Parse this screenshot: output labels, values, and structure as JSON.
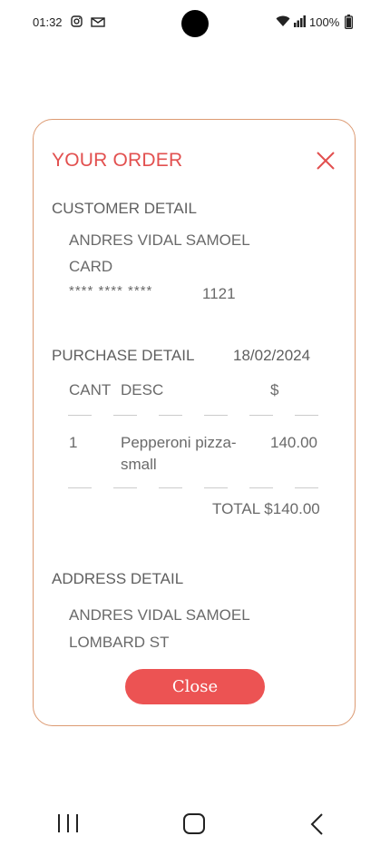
{
  "status_bar": {
    "time": "01:32",
    "battery": "100%",
    "icons": [
      "instagram-icon",
      "mail-icon",
      "wifi-icon",
      "signal-icon",
      "battery-icon"
    ]
  },
  "order": {
    "title": "YOUR ORDER",
    "customer_heading": "CUSTOMER DETAIL",
    "customer_name": "ANDRES VIDAL SAMOEL",
    "payment_method": "CARD",
    "card_mask": "****  ****  ****",
    "card_last4": "1121",
    "purchase_heading": "PURCHASE  DETAIL",
    "purchase_date": "18/02/2024",
    "columns": {
      "qty": "CANT",
      "desc": "DESC",
      "price": "$"
    },
    "items": [
      {
        "qty": "1",
        "desc_line1": "Pepperoni pizza-",
        "desc_line2": "small",
        "price": "140.00"
      }
    ],
    "total": "TOTAL $140.00",
    "address_heading": "ADDRESS DETAIL",
    "address_name": "ANDRES VIDAL SAMOEL",
    "address_street": "LOMBARD ST",
    "close_label": "Close"
  },
  "colors": {
    "accent": "#e2504f",
    "button": "#ec5353",
    "card_border": "#dc9a72"
  }
}
